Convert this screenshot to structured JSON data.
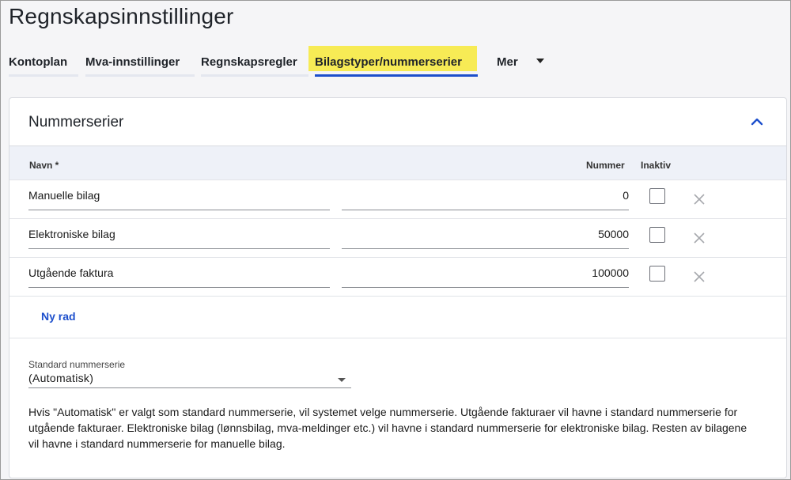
{
  "page": {
    "title": "Regnskapsinnstillinger"
  },
  "tabs": [
    {
      "label": "Kontoplan"
    },
    {
      "label": "Mva-innstillinger"
    },
    {
      "label": "Regnskapsregler"
    },
    {
      "label": "Bilagstyper/nummerserier",
      "active": true
    },
    {
      "label": "Mer"
    }
  ],
  "section": {
    "title": "Nummerserier",
    "columns": {
      "name": "Navn *",
      "number": "Nummer",
      "inactive": "Inaktiv"
    },
    "rows": [
      {
        "name": "Manuelle bilag",
        "number": "0",
        "inactive": false
      },
      {
        "name": "Elektroniske bilag",
        "number": "50000",
        "inactive": false
      },
      {
        "name": "Utgående faktura",
        "number": "100000",
        "inactive": false
      }
    ],
    "add_row_label": "Ny rad",
    "default_series": {
      "label": "Standard nummerserie",
      "value": "(Automatisk)"
    },
    "info_text": "Hvis \"Automatisk\" er valgt som standard nummerserie, vil systemet velge nummerserie. Utgående fakturaer vil havne i standard nummerserie for utgående fakturaer. Elektroniske bilag (lønnsbilag, mva-meldinger etc.) vil havne i standard nummerserie for elektroniske bilag. Resten av bilagene vil havne i standard nummerserie for manuelle bilag."
  },
  "colors": {
    "accent": "#1d4fcc",
    "highlight": "#f7eb55",
    "header_bg": "#eef1f8"
  }
}
